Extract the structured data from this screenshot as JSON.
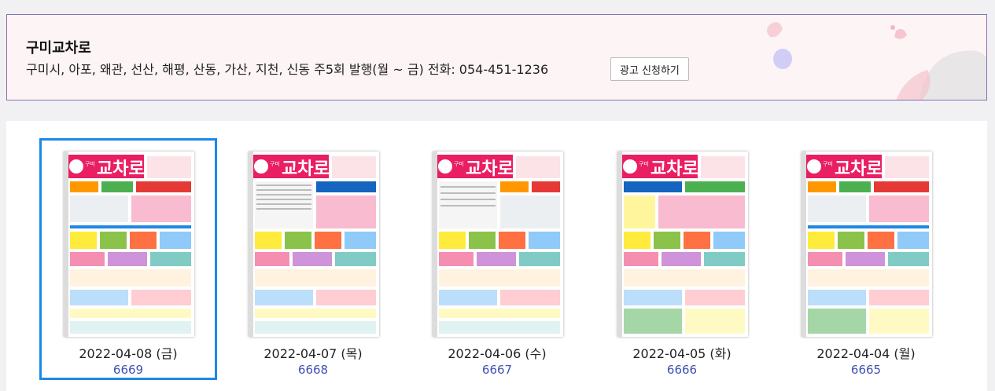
{
  "header": {
    "title": "구미교차로",
    "info": "구미시, 아포, 왜관, 선산, 해평, 산동, 가산, 지천, 신동 주5회 발행(월 ~ 금) 전화: 054-451-1236",
    "ad_button_label": "광고 신청하기"
  },
  "thumbnail": {
    "masthead_prefix": "구미",
    "masthead": "교차로"
  },
  "issues": [
    {
      "date": "2022-04-08 (금)",
      "number": "6669",
      "selected": true
    },
    {
      "date": "2022-04-07 (목)",
      "number": "6668",
      "selected": false
    },
    {
      "date": "2022-04-06 (수)",
      "number": "6667",
      "selected": false
    },
    {
      "date": "2022-04-05 (화)",
      "number": "6666",
      "selected": false
    },
    {
      "date": "2022-04-04 (월)",
      "number": "6665",
      "selected": false
    }
  ],
  "colors": {
    "accent": "#1e88e5",
    "link": "#3f51b5",
    "header_border": "#8a6fb0",
    "masthead_pink": "#e91e63"
  }
}
